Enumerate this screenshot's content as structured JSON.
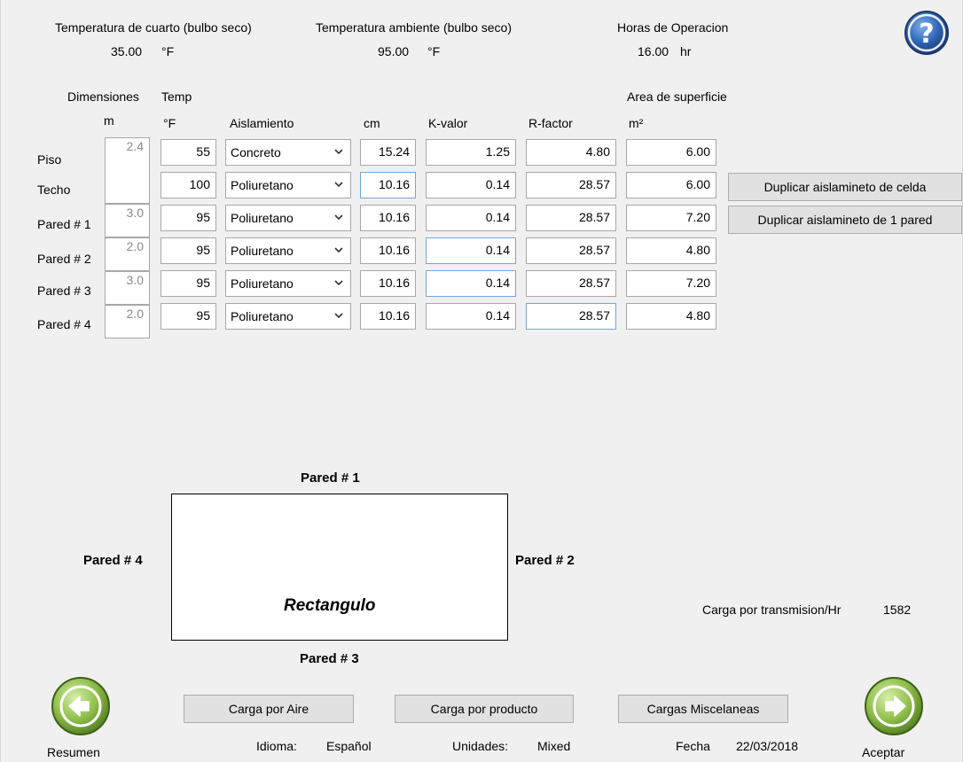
{
  "header": {
    "room_temp_label": "Temperatura de cuarto (bulbo seco)",
    "room_temp_value": "35.00",
    "room_temp_unit": "°F",
    "ambient_temp_label": "Temperatura ambiente (bulbo seco)",
    "ambient_temp_value": "95.00",
    "ambient_temp_unit": "°F",
    "hours_label": "Horas de Operacion",
    "hours_value": "16.00",
    "hours_unit": "hr",
    "help_icon": "question-mark-icon"
  },
  "columns": {
    "dimensions": "Dimensiones",
    "dimensions_unit": "m",
    "temp": "Temp",
    "temp_unit": "°F",
    "insulation": "Aislamiento",
    "thickness_unit": "cm",
    "kvalue": "K-valor",
    "rfactor": "R-factor",
    "area": "Area de superficie",
    "area_unit": "m²"
  },
  "rows": [
    {
      "label": "Piso",
      "dim": "2.4",
      "temp": "55",
      "insulation": "Concreto",
      "cm": "15.24",
      "k": "1.25",
      "r": "4.80",
      "area": "6.00"
    },
    {
      "label": "Techo",
      "dim": "",
      "temp": "100",
      "insulation": "Poliuretano",
      "cm": "10.16",
      "k": "0.14",
      "r": "28.57",
      "area": "6.00"
    },
    {
      "label": "Pared # 1",
      "dim": "3.0",
      "temp": "95",
      "insulation": "Poliuretano",
      "cm": "10.16",
      "k": "0.14",
      "r": "28.57",
      "area": "7.20"
    },
    {
      "label": "Pared # 2",
      "dim": "2.0",
      "temp": "95",
      "insulation": "Poliuretano",
      "cm": "10.16",
      "k": "0.14",
      "r": "28.57",
      "area": "4.80"
    },
    {
      "label": "Pared # 3",
      "dim": "3.0",
      "temp": "95",
      "insulation": "Poliuretano",
      "cm": "10.16",
      "k": "0.14",
      "r": "28.57",
      "area": "7.20"
    },
    {
      "label": "Pared # 4",
      "dim": "2.0",
      "temp": "95",
      "insulation": "Poliuretano",
      "cm": "10.16",
      "k": "0.14",
      "r": "28.57",
      "area": "4.80"
    }
  ],
  "buttons": {
    "duplicate_cell": "Duplicar aislamineto de celda",
    "duplicate_wall": "Duplicar aislamineto de 1 pared",
    "air_load": "Carga por Aire",
    "product_load": "Carga por producto",
    "misc_loads": "Cargas Miscelaneas",
    "back": "Resumen",
    "accept": "Aceptar"
  },
  "diagram": {
    "wall1": "Pared # 1",
    "wall2": "Pared # 2",
    "wall3": "Pared # 3",
    "wall4": "Pared # 4",
    "shape": "Rectangulo"
  },
  "transmission": {
    "label": "Carga por transmision/Hr",
    "value": "1582"
  },
  "footer": {
    "language_label": "Idioma:",
    "language_value": "Español",
    "units_label": "Unidades:",
    "units_value": "Mixed",
    "date_label": "Fecha",
    "date_value": "22/03/2018"
  },
  "colors": {
    "nav_button_green": "#8fbf4a",
    "help_blue": "#2b5fae"
  }
}
